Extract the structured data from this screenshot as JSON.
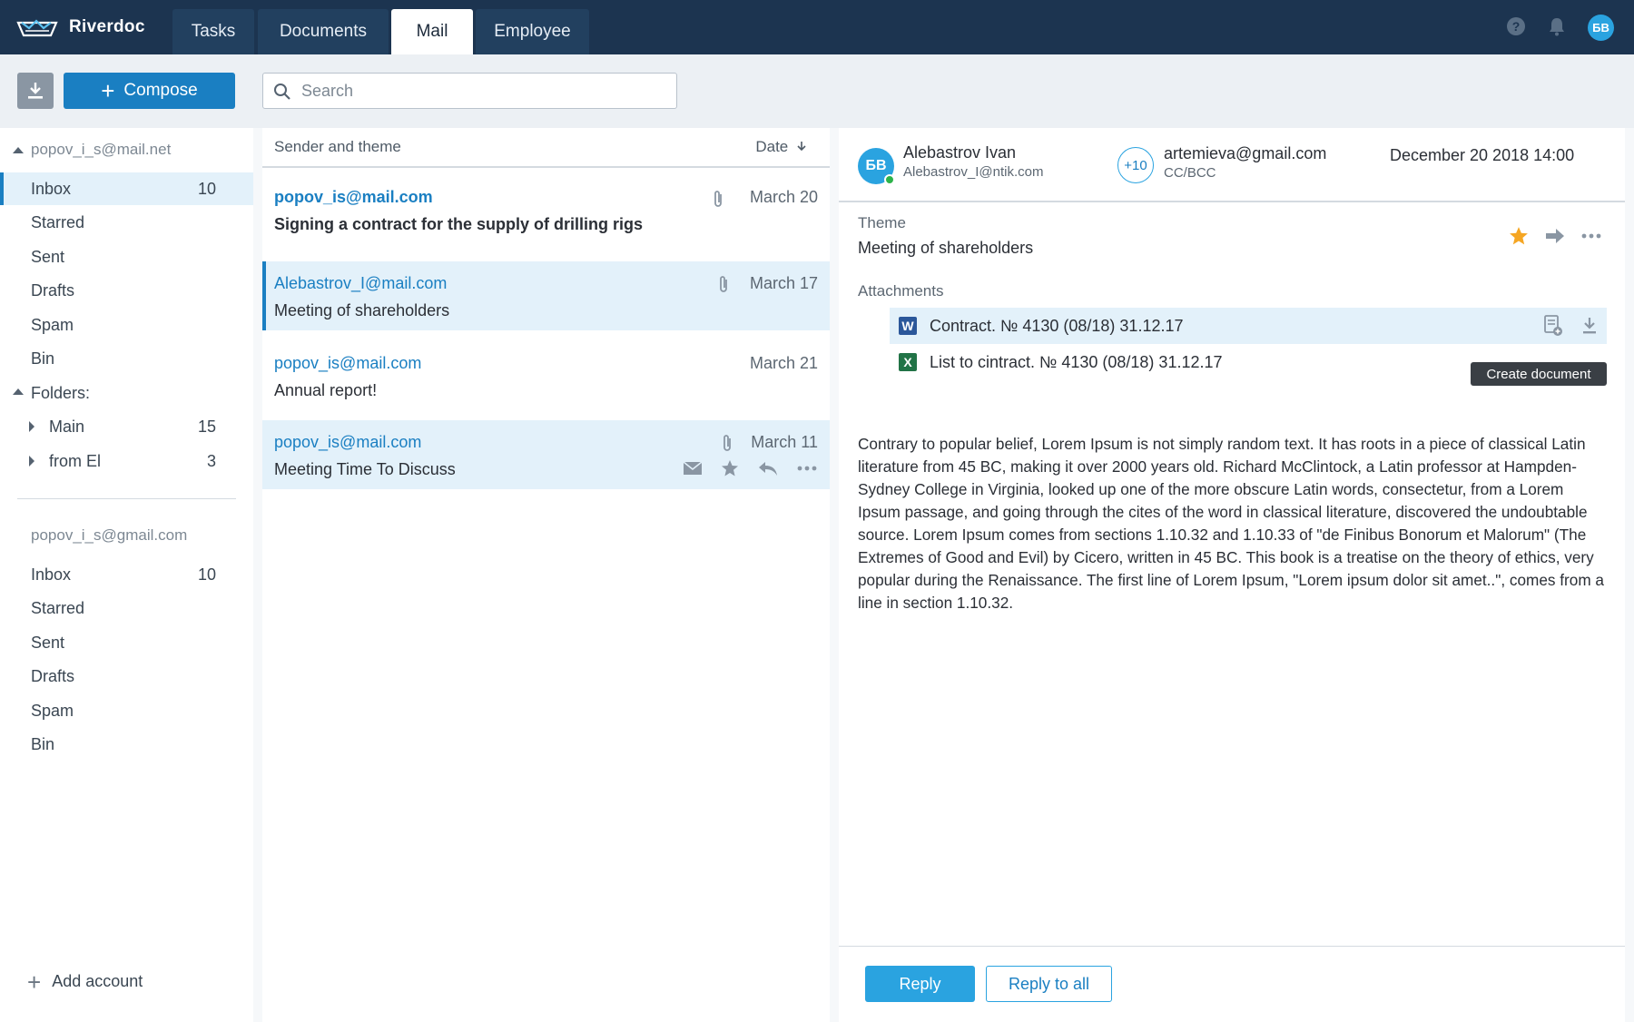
{
  "app": {
    "name": "Riverdoc"
  },
  "tabs": [
    {
      "label": "Tasks",
      "active": false
    },
    {
      "label": "Documents",
      "active": false
    },
    {
      "label": "Mail",
      "active": true
    },
    {
      "label": "Employee",
      "active": false
    }
  ],
  "user": {
    "initials": "БВ"
  },
  "toolbar": {
    "compose_label": "Compose",
    "search_placeholder": "Search"
  },
  "sidebar": {
    "account1": {
      "email": "popov_i_s@mail.net",
      "items": [
        {
          "label": "Inbox",
          "count": "10",
          "active": true
        },
        {
          "label": "Starred",
          "count": ""
        },
        {
          "label": "Sent",
          "count": ""
        },
        {
          "label": "Drafts",
          "count": ""
        },
        {
          "label": "Spam",
          "count": ""
        },
        {
          "label": "Bin",
          "count": ""
        }
      ],
      "folders_label": "Folders:",
      "folders": [
        {
          "label": "Main",
          "count": "15"
        },
        {
          "label": "from El",
          "count": "3"
        }
      ]
    },
    "account2": {
      "email": "popov_i_s@gmail.com",
      "items": [
        {
          "label": "Inbox",
          "count": "10"
        },
        {
          "label": "Starred",
          "count": ""
        },
        {
          "label": "Sent",
          "count": ""
        },
        {
          "label": "Drafts",
          "count": ""
        },
        {
          "label": "Spam",
          "count": ""
        },
        {
          "label": "Bin",
          "count": ""
        }
      ]
    },
    "add_account": "Add account"
  },
  "list": {
    "col_sender": "Sender and theme",
    "col_date": "Date",
    "mails": [
      {
        "from": "popov_is@mail.com",
        "subject": "Signing a contract for the supply of drilling rigs",
        "date": "March 20",
        "attachment": true,
        "unread": true
      },
      {
        "from": "Alebastrov_I@mail.com",
        "subject": "Meeting of shareholders",
        "date": "March 17",
        "attachment": true,
        "selected": true
      },
      {
        "from": "popov_is@mail.com",
        "subject": "Annual report!",
        "date": "March 21",
        "attachment": false
      },
      {
        "from": "popov_is@mail.com",
        "subject": "Meeting Time To Discuss",
        "date": "March 11",
        "attachment": true,
        "hovered": true
      }
    ]
  },
  "reader": {
    "sender_initials": "БВ",
    "sender_name": "Alebastrov Ivan",
    "sender_email": "Alebastrov_I@ntik.com",
    "more_recipients": "+10",
    "cc_email": "artemieva@gmail.com",
    "cc_label": "CC/BCC",
    "date": "December 20 2018 14:00",
    "theme_label": "Theme",
    "theme": "Meeting of shareholders",
    "attachments_label": "Attachments",
    "attachments": [
      {
        "type": "W",
        "name": "Contract. № 4130  (08/18) 31.12.17",
        "color": "#2b579a"
      },
      {
        "type": "X",
        "name": "List to cintract. № 4130  (08/18) 31.12.17",
        "color": "#217346"
      }
    ],
    "tooltip": "Create document",
    "body": "Contrary to popular belief, Lorem Ipsum is not simply random text. It has roots in a piece of classical Latin literature from 45 BC, making it over 2000 years old. Richard McClintock, a Latin professor at Hampden-Sydney College in Virginia, looked up one of the more obscure Latin words, consectetur, from a Lorem Ipsum passage, and going through the cites of the word in classical literature, discovered the undoubtable source. Lorem Ipsum comes from sections 1.10.32 and 1.10.33 of \"de Finibus Bonorum et Malorum\" (The Extremes of Good and Evil) by Cicero, written in 45 BC. This book is a treatise on the theory of ethics, very popular during the Renaissance. The first line of Lorem Ipsum, \"Lorem ipsum dolor sit amet..\", comes from a line in section 1.10.32.",
    "reply_label": "Reply",
    "reply_all_label": "Reply to all"
  },
  "colors": {
    "header": "#1c3450",
    "accent": "#1a7fc2",
    "light_accent": "#2aa3e0",
    "selected_bg": "#e3f1fa",
    "star": "#f5a623"
  }
}
